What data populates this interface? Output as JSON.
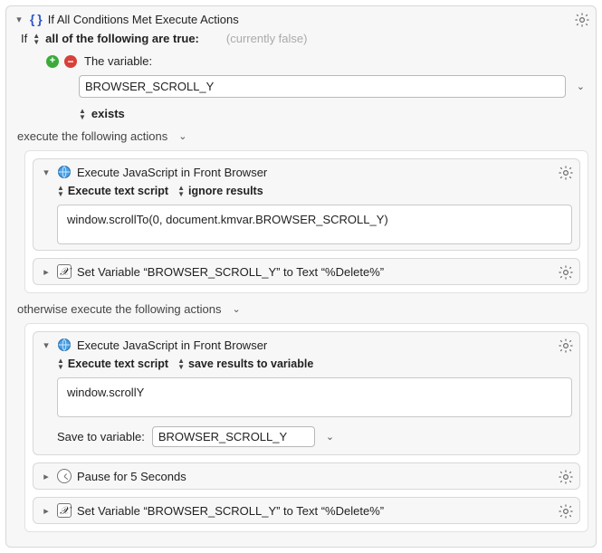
{
  "outer": {
    "title": "If All Conditions Met Execute Actions"
  },
  "if": {
    "prefix": "If",
    "predicate": "all of the following are true:",
    "status": "(currently false)"
  },
  "condition": {
    "label": "The variable:",
    "variable_value": "BROWSER_SCROLL_Y",
    "operator": "exists"
  },
  "exec_then_label": "execute the following actions",
  "exec_else_label": "otherwise execute the following actions",
  "then_actions": {
    "js": {
      "title": "Execute JavaScript in Front Browser",
      "opt_script": "Execute text script",
      "opt_result": "ignore results",
      "code": "window.scrollTo(0, document.kmvar.BROWSER_SCROLL_Y)"
    },
    "setvar": {
      "title": "Set Variable “BROWSER_SCROLL_Y” to Text “%Delete%”"
    }
  },
  "else_actions": {
    "js": {
      "title": "Execute JavaScript in Front Browser",
      "opt_script": "Execute text script",
      "opt_result": "save results to variable",
      "code": "window.scrollY",
      "save_label": "Save to variable:",
      "save_var": "BROWSER_SCROLL_Y"
    },
    "pause": {
      "title": "Pause for 5 Seconds"
    },
    "setvar": {
      "title": "Set Variable “BROWSER_SCROLL_Y” to Text “%Delete%”"
    }
  }
}
